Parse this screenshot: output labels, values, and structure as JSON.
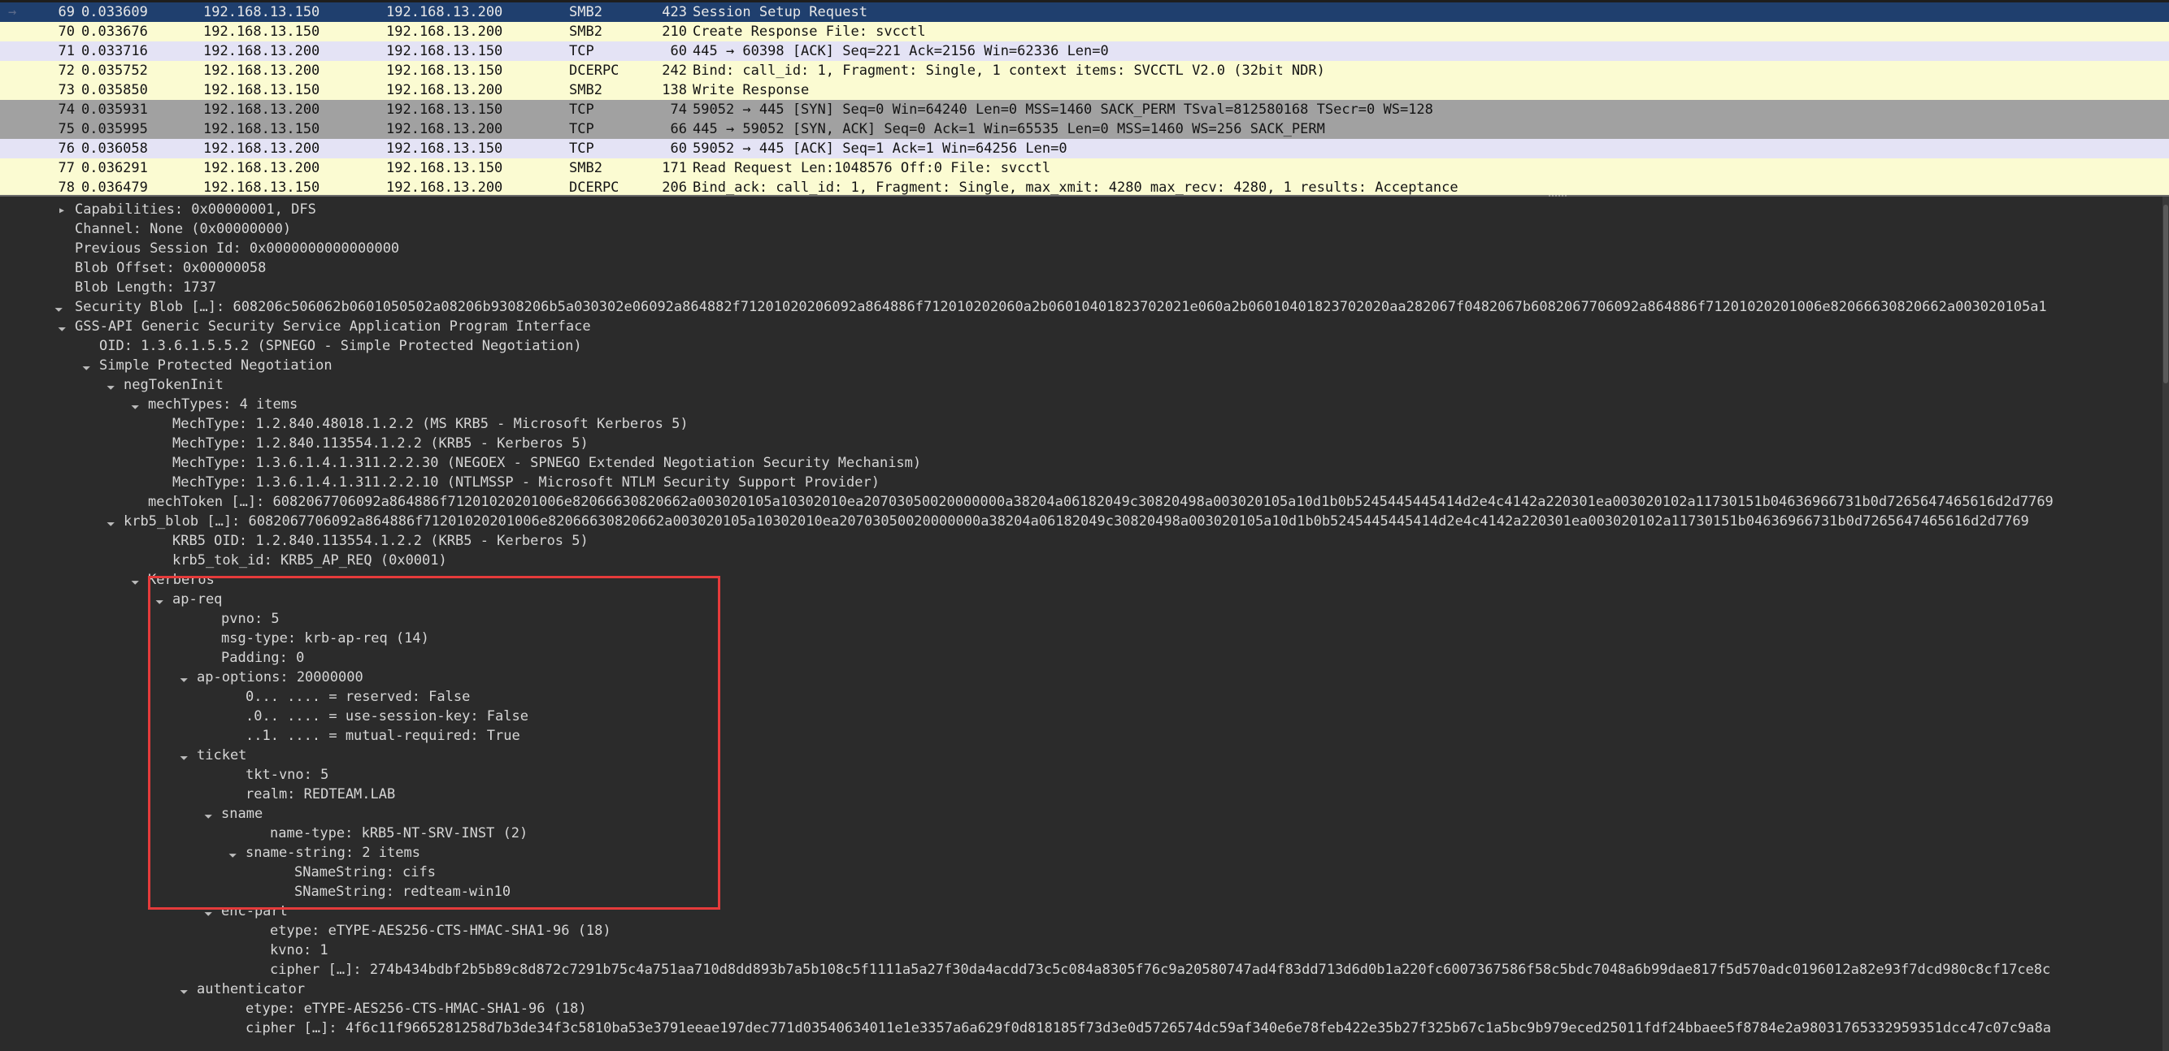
{
  "packets": [
    {
      "no": "69",
      "time": "0.033609",
      "src": "192.168.13.150",
      "dst": "192.168.13.200",
      "proto": "SMB2",
      "len": "423",
      "info": "Session Setup Request",
      "style": "selected",
      "arrow": "→"
    },
    {
      "no": "70",
      "time": "0.033676",
      "src": "192.168.13.150",
      "dst": "192.168.13.200",
      "proto": "SMB2",
      "len": "210",
      "info": "Create Response File: svcctl",
      "style": "yellow",
      "arrow": ""
    },
    {
      "no": "71",
      "time": "0.033716",
      "src": "192.168.13.200",
      "dst": "192.168.13.150",
      "proto": "TCP",
      "len": "60",
      "info": "445 → 60398 [ACK] Seq=221 Ack=2156 Win=62336 Len=0",
      "style": "lav",
      "arrow": ""
    },
    {
      "no": "72",
      "time": "0.035752",
      "src": "192.168.13.200",
      "dst": "192.168.13.150",
      "proto": "DCERPC",
      "len": "242",
      "info": "Bind: call_id: 1, Fragment: Single, 1 context items: SVCCTL V2.0 (32bit NDR)",
      "style": "yellow",
      "arrow": ""
    },
    {
      "no": "73",
      "time": "0.035850",
      "src": "192.168.13.150",
      "dst": "192.168.13.200",
      "proto": "SMB2",
      "len": "138",
      "info": "Write Response",
      "style": "yellow",
      "arrow": ""
    },
    {
      "no": "74",
      "time": "0.035931",
      "src": "192.168.13.200",
      "dst": "192.168.13.150",
      "proto": "TCP",
      "len": "74",
      "info": "59052 → 445 [SYN] Seq=0 Win=64240 Len=0 MSS=1460 SACK_PERM TSval=812580168 TSecr=0 WS=128",
      "style": "gray",
      "arrow": ""
    },
    {
      "no": "75",
      "time": "0.035995",
      "src": "192.168.13.150",
      "dst": "192.168.13.200",
      "proto": "TCP",
      "len": "66",
      "info": "445 → 59052 [SYN, ACK] Seq=0 Ack=1 Win=65535 Len=0 MSS=1460 WS=256 SACK_PERM",
      "style": "gray",
      "arrow": ""
    },
    {
      "no": "76",
      "time": "0.036058",
      "src": "192.168.13.200",
      "dst": "192.168.13.150",
      "proto": "TCP",
      "len": "60",
      "info": "59052 → 445 [ACK] Seq=1 Ack=1 Win=64256 Len=0",
      "style": "lav",
      "arrow": ""
    },
    {
      "no": "77",
      "time": "0.036291",
      "src": "192.168.13.200",
      "dst": "192.168.13.150",
      "proto": "SMB2",
      "len": "171",
      "info": "Read Request Len:1048576 Off:0 File: svcctl",
      "style": "yellow",
      "arrow": ""
    },
    {
      "no": "78",
      "time": "0.036479",
      "src": "192.168.13.150",
      "dst": "192.168.13.200",
      "proto": "DCERPC",
      "len": "206",
      "info": "Bind_ack: call_id: 1, Fragment: Single, max_xmit: 4280 max_recv: 4280, 1 results: Acceptance",
      "style": "yellow",
      "arrow": ""
    }
  ],
  "tree": [
    {
      "d": 0,
      "t": "closed",
      "text": "Capabilities: 0x00000001, DFS"
    },
    {
      "d": 0,
      "t": "none",
      "text": "Channel: None (0x00000000)"
    },
    {
      "d": 0,
      "t": "none",
      "text": "Previous Session Id: 0x0000000000000000"
    },
    {
      "d": 0,
      "t": "none",
      "text": "Blob Offset: 0x00000058"
    },
    {
      "d": 0,
      "t": "none",
      "text": "Blob Length: 1737"
    },
    {
      "d": -1,
      "t": "open",
      "text": "Security Blob […]: 608206c506062b0601050502a08206b9308206b5a030302e06092a864882f71201020206092a864886f712010202060a2b06010401823702021e060a2b06010401823702020aa282067f0482067b6082067706092a864886f71201020201006e82066630820662a003020105a1"
    },
    {
      "d": 0,
      "t": "open",
      "text": "GSS-API Generic Security Service Application Program Interface"
    },
    {
      "d": 1,
      "t": "none",
      "text": "OID: 1.3.6.1.5.5.2 (SPNEGO - Simple Protected Negotiation)"
    },
    {
      "d": 1,
      "t": "open",
      "text": "Simple Protected Negotiation"
    },
    {
      "d": 2,
      "t": "open",
      "text": "negTokenInit"
    },
    {
      "d": 3,
      "t": "open",
      "text": "mechTypes: 4 items"
    },
    {
      "d": 4,
      "t": "none",
      "text": "MechType: 1.2.840.48018.1.2.2 (MS KRB5 - Microsoft Kerberos 5)"
    },
    {
      "d": 4,
      "t": "none",
      "text": "MechType: 1.2.840.113554.1.2.2 (KRB5 - Kerberos 5)"
    },
    {
      "d": 4,
      "t": "none",
      "text": "MechType: 1.3.6.1.4.1.311.2.2.30 (NEGOEX - SPNEGO Extended Negotiation Security Mechanism)"
    },
    {
      "d": 4,
      "t": "none",
      "text": "MechType: 1.3.6.1.4.1.311.2.2.10 (NTLMSSP - Microsoft NTLM Security Support Provider)"
    },
    {
      "d": 3,
      "t": "none",
      "text": "mechToken […]: 6082067706092a864886f71201020201006e82066630820662a003020105a10302010ea20703050020000000a38204a06182049c30820498a003020105a10d1b0b5245445445414d2e4c4142a220301ea003020102a11730151b04636966731b0d7265647465616d2d7769"
    },
    {
      "d": 2,
      "t": "open",
      "text": "krb5_blob […]: 6082067706092a864886f71201020201006e82066630820662a003020105a10302010ea20703050020000000a38204a06182049c30820498a003020105a10d1b0b5245445445414d2e4c4142a220301ea003020102a11730151b04636966731b0d7265647465616d2d7769"
    },
    {
      "d": 4,
      "t": "none",
      "text": "KRB5 OID: 1.2.840.113554.1.2.2 (KRB5 - Kerberos 5)"
    },
    {
      "d": 4,
      "t": "none",
      "text": "krb5_tok_id: KRB5_AP_REQ (0x0001)"
    },
    {
      "d": 3,
      "t": "open",
      "text": "Kerberos"
    },
    {
      "d": 4,
      "t": "open",
      "text": "ap-req"
    },
    {
      "d": 6,
      "t": "none",
      "text": "pvno: 5"
    },
    {
      "d": 6,
      "t": "none",
      "text": "msg-type: krb-ap-req (14)"
    },
    {
      "d": 6,
      "t": "none",
      "text": "Padding: 0"
    },
    {
      "d": 5,
      "t": "open",
      "text": "ap-options: 20000000"
    },
    {
      "d": 7,
      "t": "none",
      "text": "0... .... = reserved: False"
    },
    {
      "d": 7,
      "t": "none",
      "text": ".0.. .... = use-session-key: False"
    },
    {
      "d": 7,
      "t": "none",
      "text": "..1. .... = mutual-required: True"
    },
    {
      "d": 5,
      "t": "open",
      "text": "ticket"
    },
    {
      "d": 7,
      "t": "none",
      "text": "tkt-vno: 5"
    },
    {
      "d": 7,
      "t": "none",
      "text": "realm: REDTEAM.LAB"
    },
    {
      "d": 6,
      "t": "open",
      "text": "sname"
    },
    {
      "d": 8,
      "t": "none",
      "text": "name-type: kRB5-NT-SRV-INST (2)"
    },
    {
      "d": 7,
      "t": "open",
      "text": "sname-string: 2 items"
    },
    {
      "d": 9,
      "t": "none",
      "text": "SNameString: cifs"
    },
    {
      "d": 9,
      "t": "none",
      "text": "SNameString: redteam-win10"
    },
    {
      "d": 6,
      "t": "open",
      "text": "enc-part"
    },
    {
      "d": 8,
      "t": "none",
      "text": "etype: eTYPE-AES256-CTS-HMAC-SHA1-96 (18)"
    },
    {
      "d": 8,
      "t": "none",
      "text": "kvno: 1"
    },
    {
      "d": 8,
      "t": "none",
      "text": "cipher […]: 274b434bdbf2b5b89c8d872c7291b75c4a751aa710d8dd893b7a5b108c5f1111a5a27f30da4acdd73c5c084a8305f76c9a20580747ad4f83dd713d6d0b1a220fc6007367586f58c5bdc7048a6b99dae817f5d570adc0196012a82e93f7dcd980c8cf17ce8c"
    },
    {
      "d": 5,
      "t": "open",
      "text": "authenticator"
    },
    {
      "d": 7,
      "t": "none",
      "text": "etype: eTYPE-AES256-CTS-HMAC-SHA1-96 (18)"
    },
    {
      "d": 7,
      "t": "none",
      "text": "cipher […]: 4f6c11f9665281258d7b3de34f3c5810ba53e3791eeae197dec771d03540634011e1e3357a6a629f0d818185f73d3e0d5726574dc59af340e6e78feb422e35b27f325b67c1a5bc9b979eced25011fdf24bbaee5f8784e2a98031765332959351dcc47c07c9a8a"
    }
  ]
}
